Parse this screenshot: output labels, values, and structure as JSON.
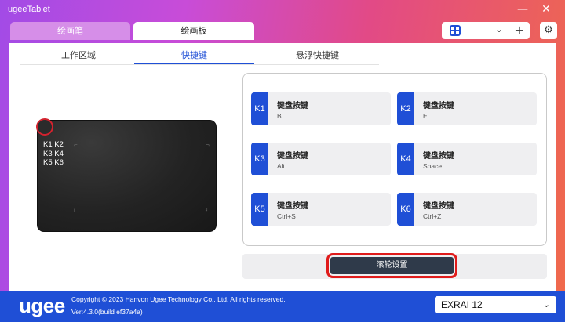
{
  "window": {
    "title": "ugeeTablet",
    "minimize_icon": "minimize-icon",
    "close_icon": "close-icon"
  },
  "main_tabs": [
    {
      "label": "绘画笔",
      "active": false
    },
    {
      "label": "绘画板",
      "active": true
    }
  ],
  "toolbar": {
    "device_icon": "grid-icon",
    "dropdown_icon": "chevron-down-icon",
    "add_icon": "plus-icon",
    "settings_icon": "gear-icon"
  },
  "sub_tabs": [
    {
      "label": "工作区域",
      "active": false
    },
    {
      "label": "快捷键",
      "active": true
    },
    {
      "label": "悬浮快捷键",
      "active": false
    }
  ],
  "tablet": {
    "keys_lines": [
      "K1 K2",
      "K3 K4",
      "K5 K6"
    ]
  },
  "shortcut_keys": [
    {
      "id": "K1",
      "type": "键盘按键",
      "value": "B"
    },
    {
      "id": "K2",
      "type": "键盘按键",
      "value": "E"
    },
    {
      "id": "K3",
      "type": "键盘按键",
      "value": "Alt"
    },
    {
      "id": "K4",
      "type": "键盘按键",
      "value": "Space"
    },
    {
      "id": "K5",
      "type": "键盘按键",
      "value": "Ctrl+S"
    },
    {
      "id": "K6",
      "type": "键盘按键",
      "value": "Ctrl+Z"
    }
  ],
  "scroll_settings_button": "滚轮设置",
  "footer": {
    "logo": "ugee",
    "copyright": "Copyright © 2023 Hanvon Ugee Technology Co., Ltd. All rights reserved.",
    "version": "Ver:4.3.0(build ef37a4a)",
    "model": "EXRAI 12"
  },
  "colors": {
    "accent": "#1f4fd6",
    "highlight": "#e01b1b",
    "button_dark": "#2f3a4a"
  }
}
